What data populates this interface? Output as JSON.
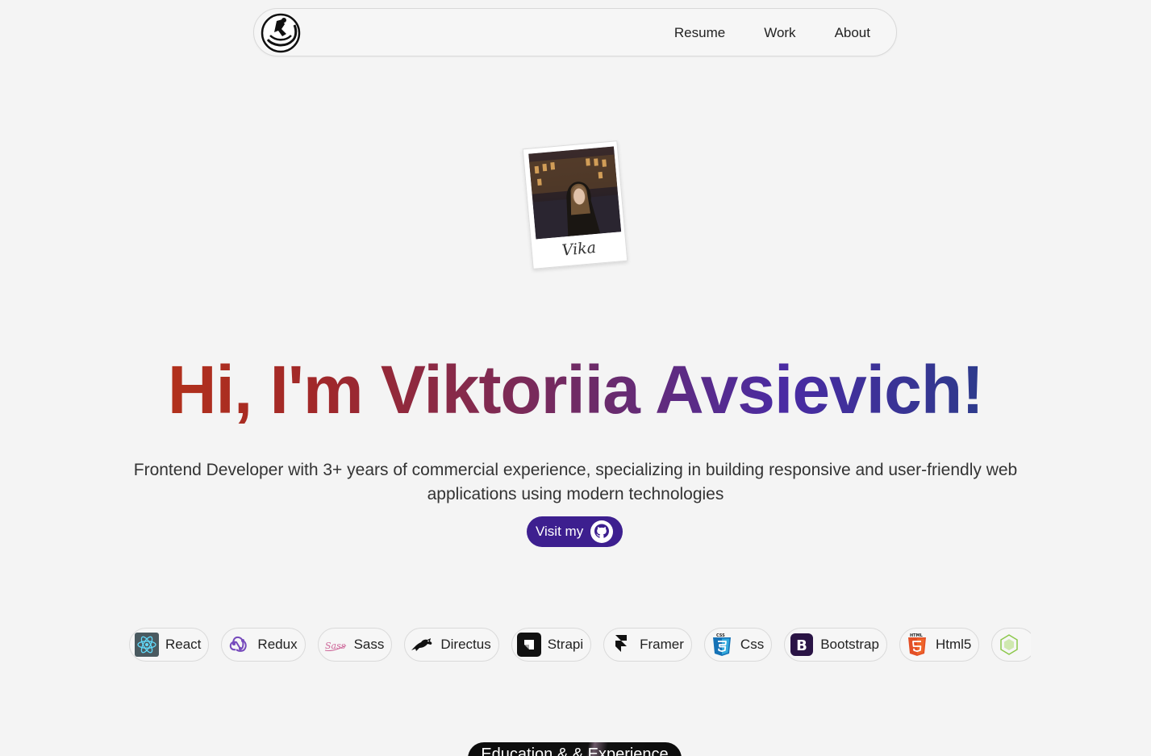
{
  "nav": {
    "links": [
      "Resume",
      "Work",
      "About"
    ]
  },
  "polaroid": {
    "caption": "Vika"
  },
  "hero": {
    "title": "Hi, I'm Viktoriia Avsievich!",
    "subtitle": "Frontend Developer with 3+ years of commercial experience, specializing in building responsive and user-friendly web applications using modern technologies",
    "github_button": "Visit my",
    "gradient_colors": [
      "#c53a0c",
      "#a0282a",
      "#6c2b6a",
      "#4a2ba3",
      "#2e3a8c",
      "#1f5e7a"
    ]
  },
  "skills": [
    {
      "label": "React",
      "icon": "react-icon"
    },
    {
      "label": "Redux",
      "icon": "redux-icon"
    },
    {
      "label": "Sass",
      "icon": "sass-icon"
    },
    {
      "label": "Directus",
      "icon": "directus-icon"
    },
    {
      "label": "Strapi",
      "icon": "strapi-icon"
    },
    {
      "label": "Framer",
      "icon": "framer-icon"
    },
    {
      "label": "Css",
      "icon": "css3-icon"
    },
    {
      "label": "Bootstrap",
      "icon": "bootstrap-icon"
    },
    {
      "label": "Html5",
      "icon": "html5-icon"
    },
    {
      "label": "",
      "icon": "nodejs-icon"
    }
  ],
  "section": {
    "title": "Education & & Experience"
  },
  "colors": {
    "background": "#f4f4f4",
    "button": "#3d1f8f"
  }
}
